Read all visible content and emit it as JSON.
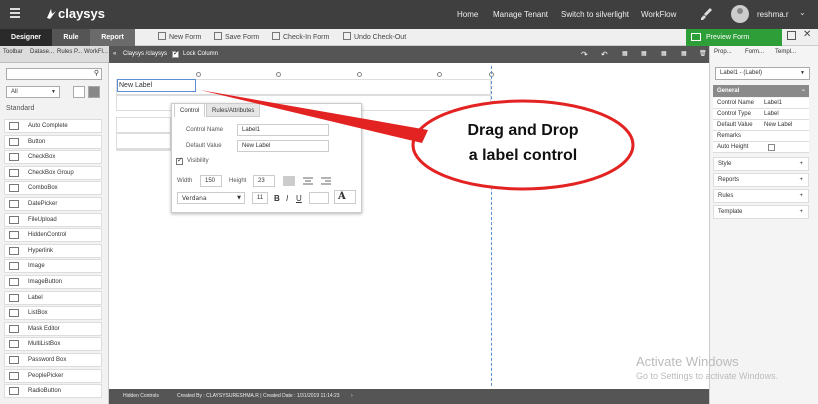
{
  "app": {
    "logo": "claysys",
    "nav": [
      "Home",
      "Manage Tenant",
      "Switch to silverlight",
      "WorkFlow"
    ],
    "user": "reshma.r"
  },
  "mode_tabs": [
    "Designer",
    "Rule",
    "Report"
  ],
  "toolbar": {
    "new_form": "New Form",
    "save_form": "Save Form",
    "check_in": "Check-In Form",
    "undo_checkout": "Undo Check-Out",
    "preview": "Preview Form"
  },
  "left": {
    "tabs": [
      "Toolbar",
      "Datase...",
      "Rules P...",
      "WorkFl..."
    ],
    "filter": "All",
    "section": "Standard",
    "items": [
      "Auto Complete",
      "Button",
      "CheckBox",
      "CheckBox Group",
      "ComboBox",
      "DatePicker",
      "FileUpload",
      "HiddenControl",
      "Hyperlink",
      "Image",
      "ImageButton",
      "Label",
      "ListBox",
      "Mask Editor",
      "MultiListBox",
      "Password Box",
      "PeoplePicker",
      "RadioButton"
    ]
  },
  "breadcrumb": {
    "path": "Claysys /claysys",
    "lock": "Lock Column"
  },
  "canvas": {
    "label_text": "New Label"
  },
  "popup": {
    "tabs": [
      "Control",
      "Rules/Attributes"
    ],
    "control_name_label": "Control Name",
    "control_name": "Label1",
    "default_value_label": "Default Value",
    "default_value": "New Label",
    "visibility": "Visibility",
    "width_label": "Width",
    "width": "150",
    "height_label": "Height",
    "height": "23",
    "font": "Verdana",
    "size": "11",
    "bold": "B",
    "italic": "I",
    "underline": "U",
    "text_color": "A"
  },
  "callout": {
    "line1": "Drag and Drop",
    "line2": "a label control"
  },
  "status": {
    "hidden": "Hidden Controls",
    "created_by": "Created By : CLAYSYSURESHMA.R | Created Date : 1/31/2019 11:14:23"
  },
  "right": {
    "tabs": [
      "Prop...",
      "Form...",
      "Templ..."
    ],
    "selected": "Label1 - (Label)",
    "general": "General",
    "props": [
      {
        "k": "Control Name",
        "v": "Label1"
      },
      {
        "k": "Control Type",
        "v": "Label"
      },
      {
        "k": "Default Value",
        "v": "New Label"
      },
      {
        "k": "Remarks",
        "v": ""
      },
      {
        "k": "Auto Height",
        "v": ""
      }
    ],
    "sections": [
      "Style",
      "Reports",
      "Rules",
      "Template"
    ]
  },
  "watermark": {
    "line1": "Activate Windows",
    "line2": "Go to Settings to activate Windows."
  }
}
